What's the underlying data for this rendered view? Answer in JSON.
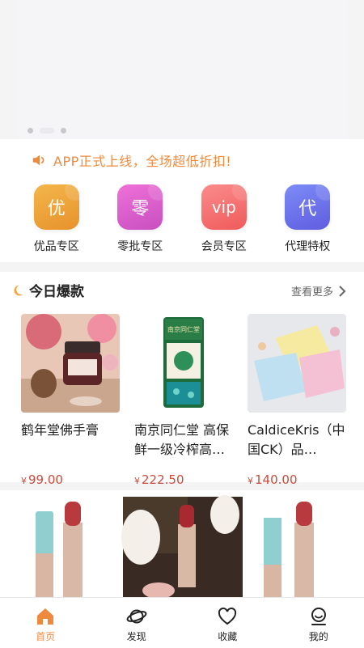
{
  "notice": {
    "text": "APP正式上线，全场超低折扣!"
  },
  "categories": [
    {
      "icon_text": "优",
      "label": "优品专区",
      "color_top": "#f3b64a",
      "color_bottom": "#e8922c"
    },
    {
      "icon_text": "零",
      "label": "零批专区",
      "color_top": "#ef72d8",
      "color_bottom": "#c84ec1"
    },
    {
      "icon_text": "vip",
      "label": "会员专区",
      "color_top": "#fb8c8c",
      "color_bottom": "#f05a5a"
    },
    {
      "icon_text": "代",
      "label": "代理特权",
      "color_top": "#7d8cf6",
      "color_bottom": "#5f5de0"
    }
  ],
  "hot": {
    "title": "今日爆款",
    "more": "查看更多",
    "products": [
      {
        "name": "鹤年堂佛手膏",
        "currency": "¥",
        "price": "99.00"
      },
      {
        "name": "南京同仁堂 高保鲜一级冷榨高…",
        "currency": "¥",
        "price": "222.50"
      },
      {
        "name": "CaldiceKris（中国CK）品…",
        "currency": "¥",
        "price": "140.00"
      }
    ],
    "can_label": "南京同仁堂"
  },
  "tabs": [
    {
      "label": "首页",
      "icon": "home-icon",
      "active": true
    },
    {
      "label": "发现",
      "icon": "planet-icon",
      "active": false
    },
    {
      "label": "收藏",
      "icon": "heart-icon",
      "active": false
    },
    {
      "label": "我的",
      "icon": "profile-icon",
      "active": false
    }
  ],
  "colors": {
    "accent": "#ee8a3d",
    "price": "#c94b3c"
  }
}
